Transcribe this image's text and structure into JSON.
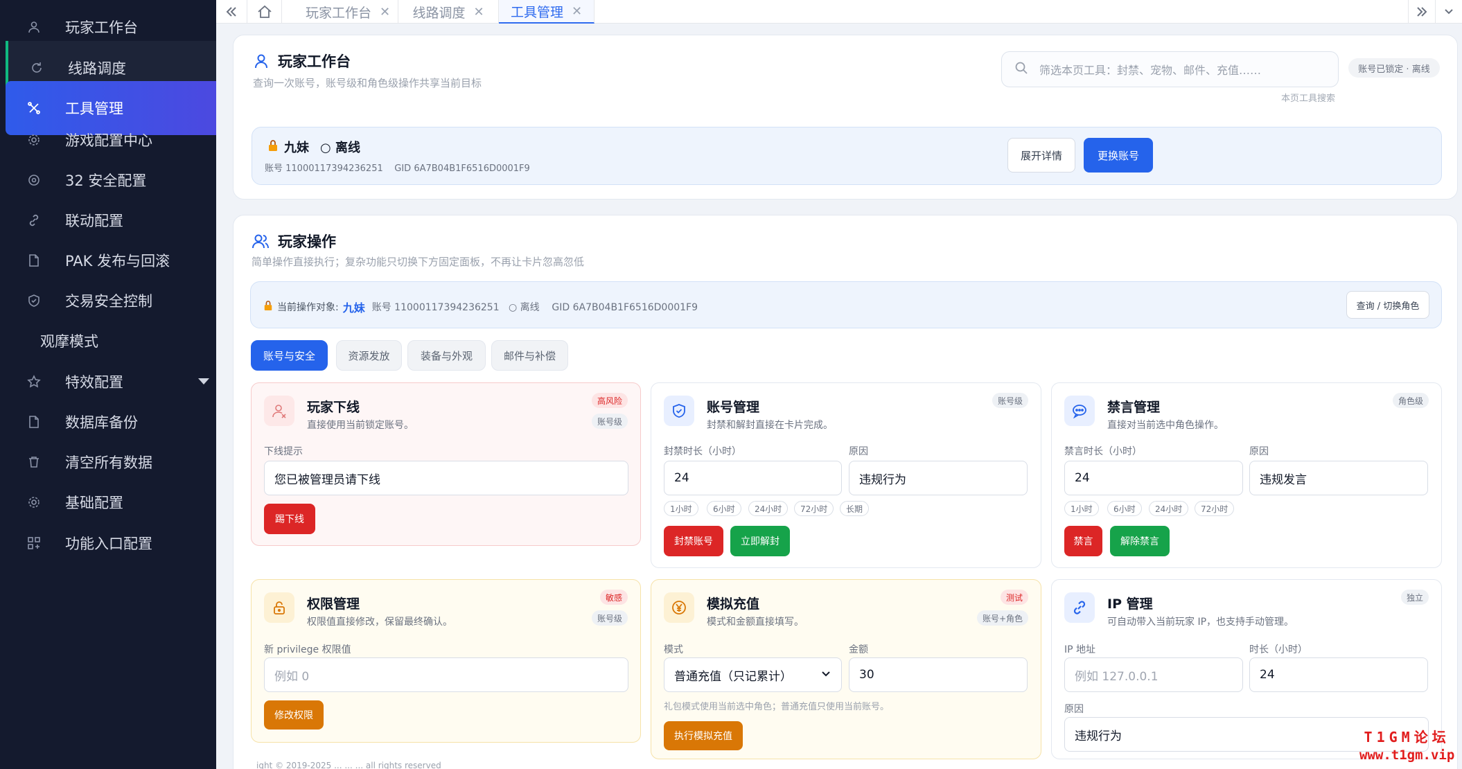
{
  "sidebar": {
    "items": [
      {
        "label": "玩家工作台",
        "icon": "user-icon"
      },
      {
        "label": "线路调度",
        "icon": "refresh-icon"
      },
      {
        "label": "工具管理",
        "icon": "tools-icon"
      },
      {
        "label": "游戏配置中心",
        "icon": "gear-icon"
      },
      {
        "label": "32 安全配置",
        "icon": "shield-gear-icon"
      },
      {
        "label": "联动配置",
        "icon": "link-icon"
      },
      {
        "label": "PAK 发布与回滚",
        "icon": "file-icon"
      },
      {
        "label": "交易安全控制",
        "icon": "shield-check-icon"
      },
      {
        "label": "观摩模式",
        "icon": ""
      },
      {
        "label": "特效配置",
        "icon": "star-icon"
      },
      {
        "label": "数据库备份",
        "icon": "file-icon"
      },
      {
        "label": "清空所有数据",
        "icon": "trash-icon"
      },
      {
        "label": "基础配置",
        "icon": "gear-icon"
      },
      {
        "label": "功能入口配置",
        "icon": "grid-icon"
      }
    ]
  },
  "tabs": [
    {
      "label": "玩家工作台"
    },
    {
      "label": "线路调度"
    },
    {
      "label": "工具管理"
    }
  ],
  "workbench": {
    "title": "玩家工作台",
    "subtitle": "查询一次账号，账号级和角色级操作共享当前目标",
    "search_placeholder": "筛选本页工具：封禁、宠物、邮件、充值……",
    "search_hint": "本页工具搜索",
    "lock_badge": "账号已锁定 · 离线",
    "player_name": "九妹",
    "player_status": "○ 离线",
    "player_meta": "账号 11000117394236251    GID 6A7B04B1F6516D0001F9",
    "expand_button": "展开详情",
    "switch_button": "更换账号"
  },
  "operations": {
    "title": "玩家操作",
    "subtitle": "简单操作直接执行；复杂功能只切换下方固定面板，不再让卡片忽高忽低",
    "target_label": "当前操作对象:",
    "target_name": "九妹",
    "target_meta": "账号 11000117394236251   ○ 离线    GID 6A7B04B1F6516D0001F9",
    "query_button": "查询 / 切换角色",
    "segments": [
      "账号与安全",
      "资源发放",
      "装备与外观",
      "邮件与补偿"
    ]
  },
  "cards": {
    "kick": {
      "title": "玩家下线",
      "desc": "直接使用当前锁定账号。",
      "tag1": "高风险",
      "tag2": "账号级",
      "field_label": "下线提示",
      "field_value": "您已被管理员请下线",
      "button": "踢下线"
    },
    "account": {
      "title": "账号管理",
      "desc": "封禁和解封直接在卡片完成。",
      "tag1": "账号级",
      "duration_label": "封禁时长（小时）",
      "duration_value": "24",
      "reason_label": "原因",
      "reason_value": "违规行为",
      "chips": [
        "1小时",
        "6小时",
        "24小时",
        "72小时",
        "长期"
      ],
      "button_ban": "封禁账号",
      "button_unban": "立即解封"
    },
    "mute": {
      "title": "禁言管理",
      "desc": "直接对当前选中角色操作。",
      "tag1": "角色级",
      "duration_label": "禁言时长（小时）",
      "duration_value": "24",
      "reason_label": "原因",
      "reason_value": "违规发言",
      "chips": [
        "1小时",
        "6小时",
        "24小时",
        "72小时"
      ],
      "button_mute": "禁言",
      "button_unmute": "解除禁言"
    },
    "privilege": {
      "title": "权限管理",
      "desc": "权限值直接修改，保留最终确认。",
      "tag1": "敏感",
      "tag2": "账号级",
      "field_label": "新 privilege 权限值",
      "field_placeholder": "例如 0",
      "button": "修改权限"
    },
    "recharge": {
      "title": "模拟充值",
      "desc": "模式和金额直接填写。",
      "tag1": "测试",
      "tag2": "账号+角色",
      "mode_label": "模式",
      "mode_value": "普通充值（只记累计）",
      "amount_label": "金额",
      "amount_value": "30",
      "note": "礼包模式使用当前选中角色；普通充值只使用当前账号。",
      "button": "执行模拟充值"
    },
    "ip": {
      "title": "IP 管理",
      "desc": "可自动带入当前玩家 IP，也支持手动管理。",
      "tag1": "独立",
      "ip_label": "IP 地址",
      "ip_placeholder": "例如 127.0.0.1",
      "hours_label": "时长（小时）",
      "hours_value": "24",
      "reason_label": "原因",
      "reason_value": "违规行为"
    }
  },
  "footer": {
    "text": "ight © 2019-2025 ... ... ... all rights reserved"
  },
  "watermark": {
    "line1": "T1GM论坛",
    "line2": "www.t1gm.vip"
  },
  "colors": {
    "sidebar": "#141a2e",
    "accent": "#2563eb",
    "danger": "#dc2626",
    "success": "#16a34a",
    "warning": "#d97706"
  }
}
